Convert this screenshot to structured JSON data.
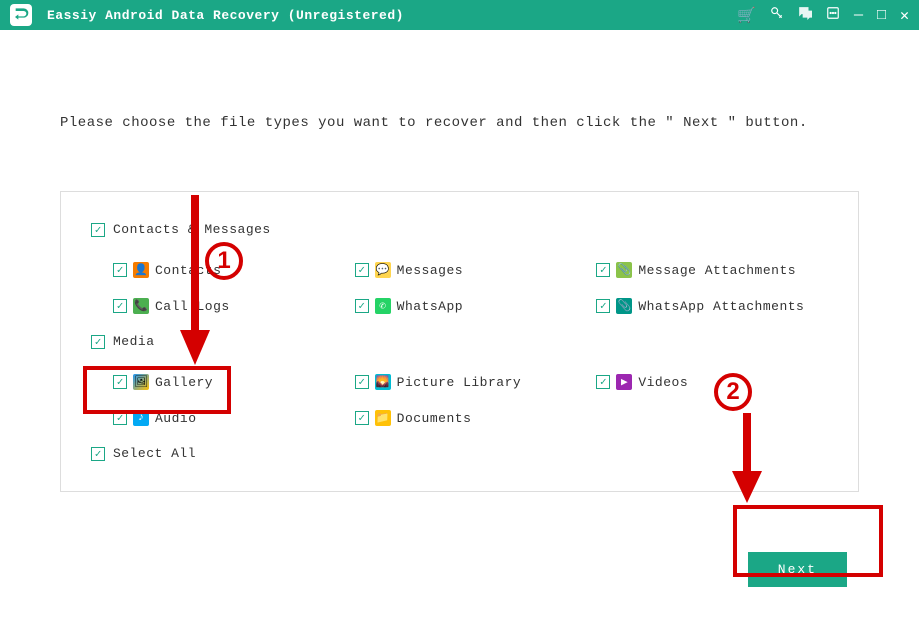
{
  "titlebar": {
    "title": "Eassiy Android Data Recovery (Unregistered)"
  },
  "instruction": "Please choose the file types you want to recover and then click the \" Next \" button.",
  "sections": {
    "contacts_messages": {
      "header": "Contacts & Messages",
      "items": {
        "contacts": "Contacts",
        "messages": "Messages",
        "message_attachments": "Message Attachments",
        "call_logs": "Call Logs",
        "whatsapp": "WhatsApp",
        "whatsapp_attachments": "WhatsApp Attachments"
      }
    },
    "media": {
      "header": "Media",
      "items": {
        "gallery": "Gallery",
        "picture_library": "Picture Library",
        "videos": "Videos",
        "audio": "Audio",
        "documents": "Documents"
      }
    }
  },
  "select_all": "Select All",
  "next_button": "Next",
  "annotations": {
    "badge1": "1",
    "badge2": "2"
  }
}
